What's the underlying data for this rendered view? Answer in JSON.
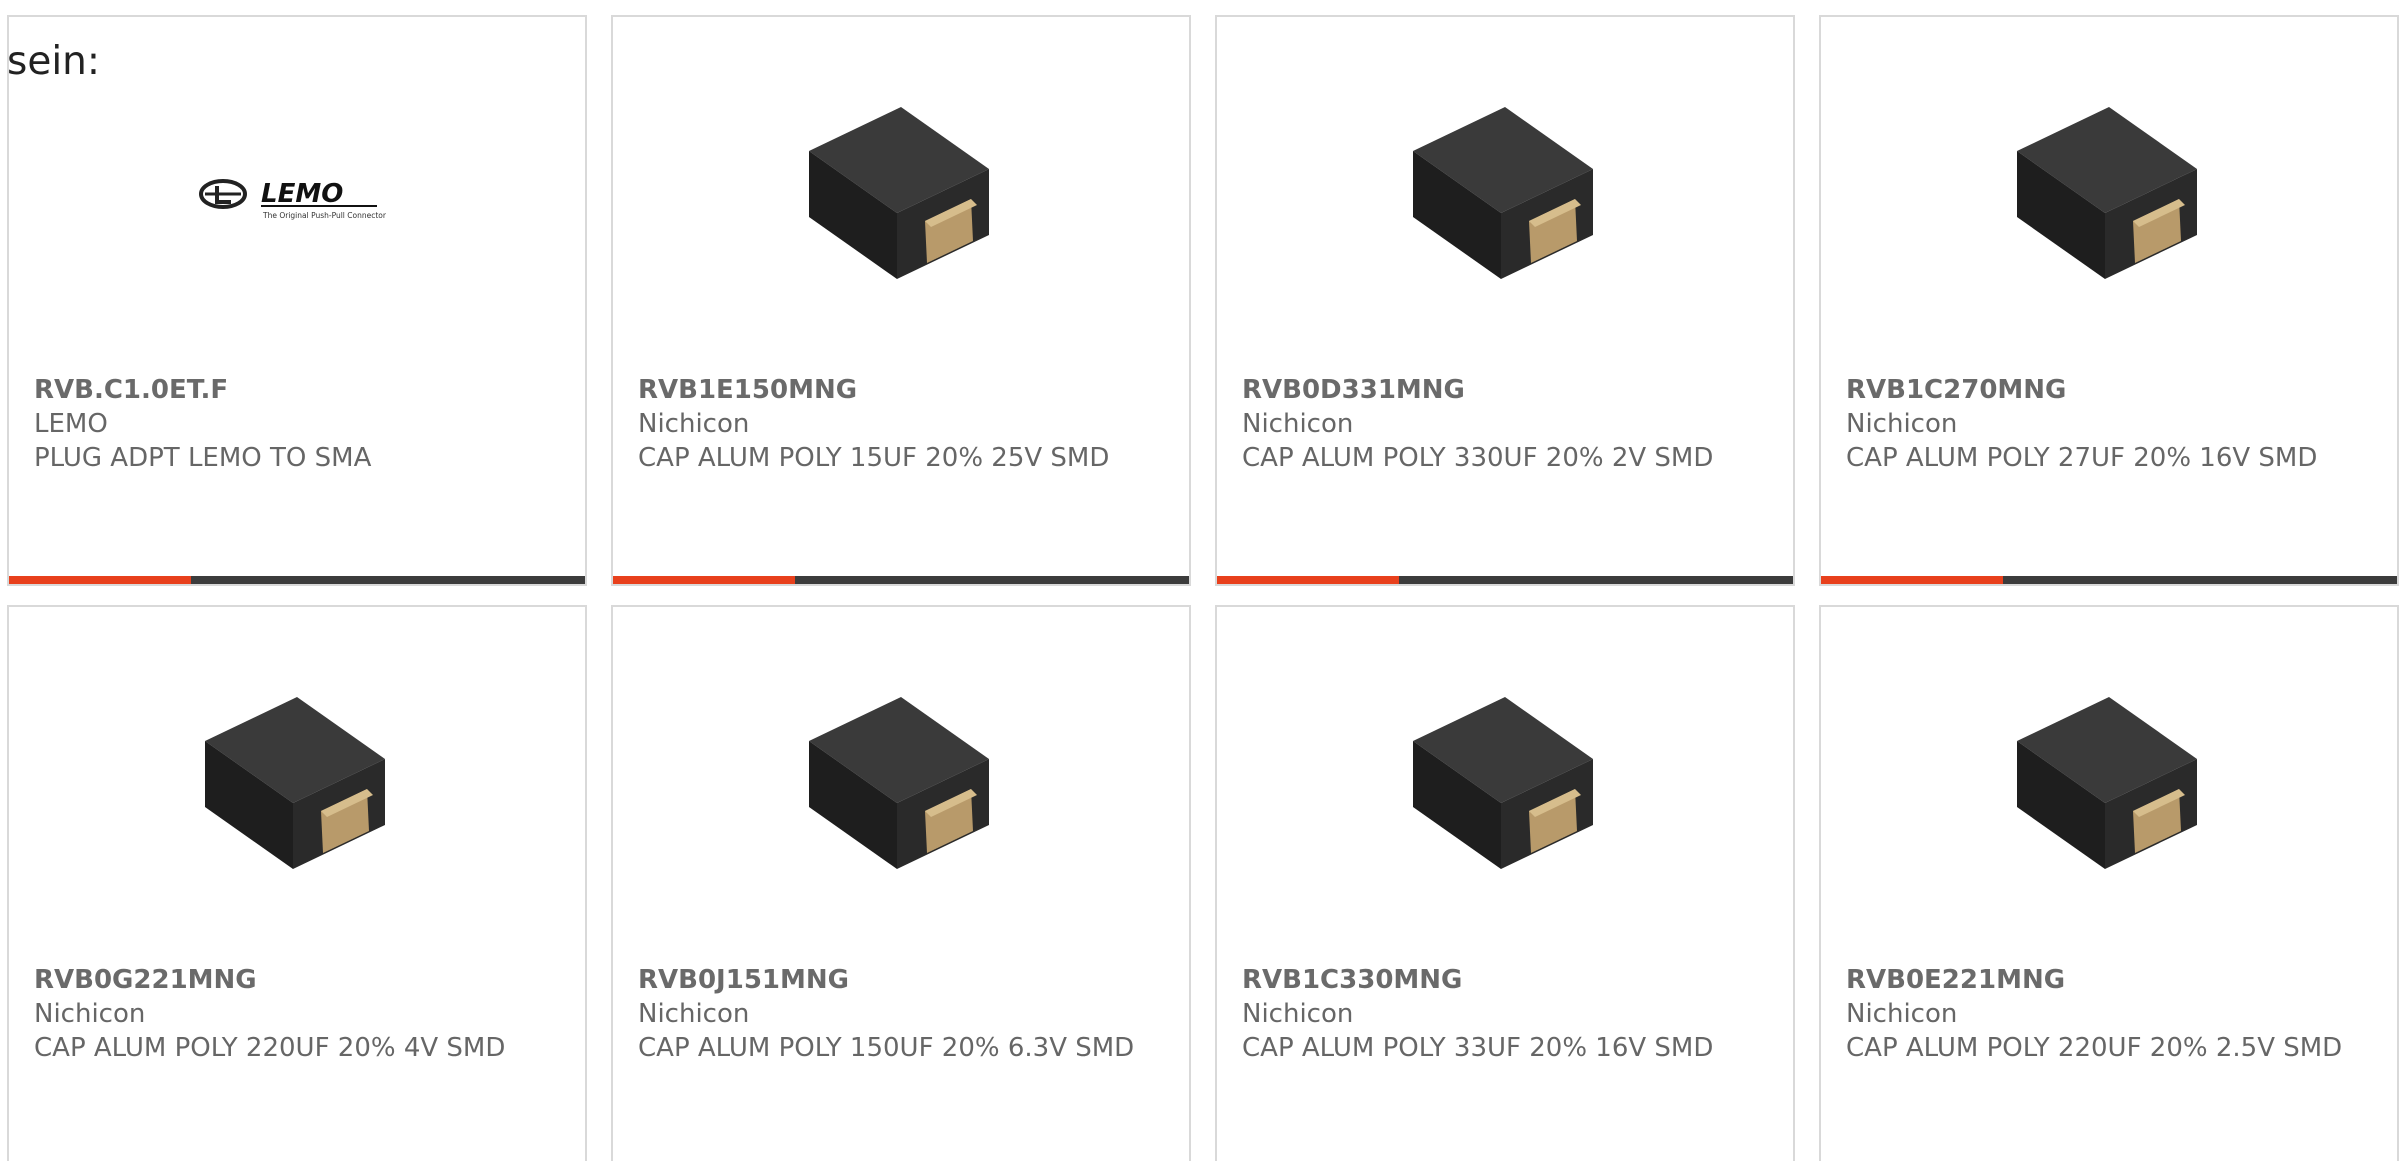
{
  "header": {
    "label": "sein:"
  },
  "colors": {
    "accent": "#e8401c",
    "bar": "#3c3c3c",
    "border": "#d9d9d9",
    "text": "#666666"
  },
  "products": [
    {
      "part": "RVB.C1.0ET.F",
      "manufacturer": "LEMO",
      "description": "PLUG ADPT LEMO TO SMA",
      "image": "lemo-logo",
      "logo": {
        "name": "LEMO",
        "tagline": "The Original Push-Pull Connector"
      }
    },
    {
      "part": "RVB1E150MNG",
      "manufacturer": "Nichicon",
      "description": "CAP ALUM POLY 15UF 20% 25V SMD",
      "image": "smd-capacitor"
    },
    {
      "part": "RVB0D331MNG",
      "manufacturer": "Nichicon",
      "description": "CAP ALUM POLY 330UF 20% 2V SMD",
      "image": "smd-capacitor"
    },
    {
      "part": "RVB1C270MNG",
      "manufacturer": "Nichicon",
      "description": "CAP ALUM POLY 27UF 20% 16V SMD",
      "image": "smd-capacitor"
    },
    {
      "part": "RVB0G221MNG",
      "manufacturer": "Nichicon",
      "description": "CAP ALUM POLY 220UF 20% 4V SMD",
      "image": "smd-capacitor"
    },
    {
      "part": "RVB0J151MNG",
      "manufacturer": "Nichicon",
      "description": "CAP ALUM POLY 150UF 20% 6.3V SMD",
      "image": "smd-capacitor"
    },
    {
      "part": "RVB1C330MNG",
      "manufacturer": "Nichicon",
      "description": "CAP ALUM POLY 33UF 20% 16V SMD",
      "image": "smd-capacitor"
    },
    {
      "part": "RVB0E221MNG",
      "manufacturer": "Nichicon",
      "description": "CAP ALUM POLY 220UF 20% 2.5V SMD",
      "image": "smd-capacitor"
    }
  ]
}
